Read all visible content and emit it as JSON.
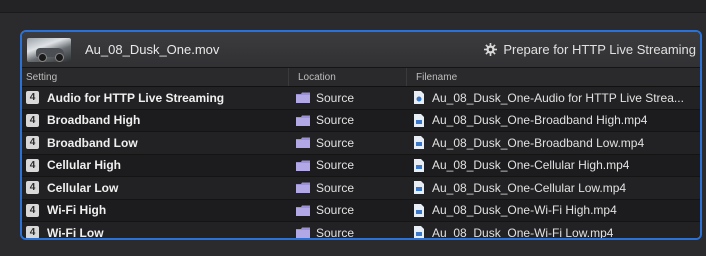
{
  "job": {
    "file_name": "Au_08_Dusk_One.mov",
    "action_label": "Prepare for HTTP Live Streaming"
  },
  "columns": {
    "setting": "Setting",
    "location": "Location",
    "filename": "Filename"
  },
  "rows": [
    {
      "badge": "4",
      "setting": "Audio for HTTP Live Streaming",
      "location": "Source",
      "filename": "Au_08_Dusk_One-Audio for HTTP Live Strea..."
    },
    {
      "badge": "4",
      "setting": "Broadband High",
      "location": "Source",
      "filename": "Au_08_Dusk_One-Broadband High.mp4"
    },
    {
      "badge": "4",
      "setting": "Broadband Low",
      "location": "Source",
      "filename": "Au_08_Dusk_One-Broadband Low.mp4"
    },
    {
      "badge": "4",
      "setting": "Cellular High",
      "location": "Source",
      "filename": "Au_08_Dusk_One-Cellular High.mp4"
    },
    {
      "badge": "4",
      "setting": "Cellular Low",
      "location": "Source",
      "filename": "Au_08_Dusk_One-Cellular Low.mp4"
    },
    {
      "badge": "4",
      "setting": "Wi-Fi High",
      "location": "Source",
      "filename": "Au_08_Dusk_One-Wi-Fi High.mp4"
    },
    {
      "badge": "4",
      "setting": "Wi-Fi Low",
      "location": "Source",
      "filename": "Au_08_Dusk_One-Wi-Fi Low.mp4"
    }
  ],
  "colors": {
    "selection_border": "#2a72d8",
    "folder": "#9b8fd6"
  }
}
